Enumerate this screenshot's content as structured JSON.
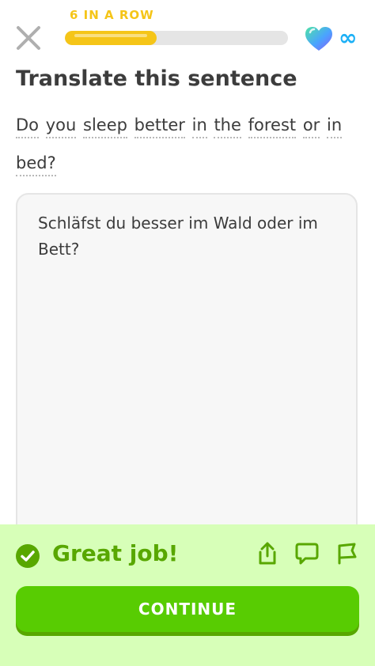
{
  "header": {
    "streak_label": "6 IN A ROW",
    "progress_fraction": 0.41,
    "hearts": "∞"
  },
  "exercise": {
    "title": "Translate this sentence",
    "prompt_words": [
      "Do",
      "you",
      "sleep",
      "better",
      "in",
      "the",
      "forest",
      "or",
      "in",
      "bed?"
    ],
    "answer": "Schläfst du besser im Wald oder im Bett?"
  },
  "feedback": {
    "message": "Great job!",
    "continue_label": "CONTINUE"
  },
  "colors": {
    "streak": "#f5c518",
    "success": "#58a700",
    "button": "#58cc02",
    "feedback_bg": "#d7ffb8",
    "infinity": "#1cb0f6"
  },
  "icons": [
    "close-icon",
    "heart-icon",
    "infinity-icon",
    "check-icon",
    "share-icon",
    "comment-icon",
    "flag-icon"
  ]
}
